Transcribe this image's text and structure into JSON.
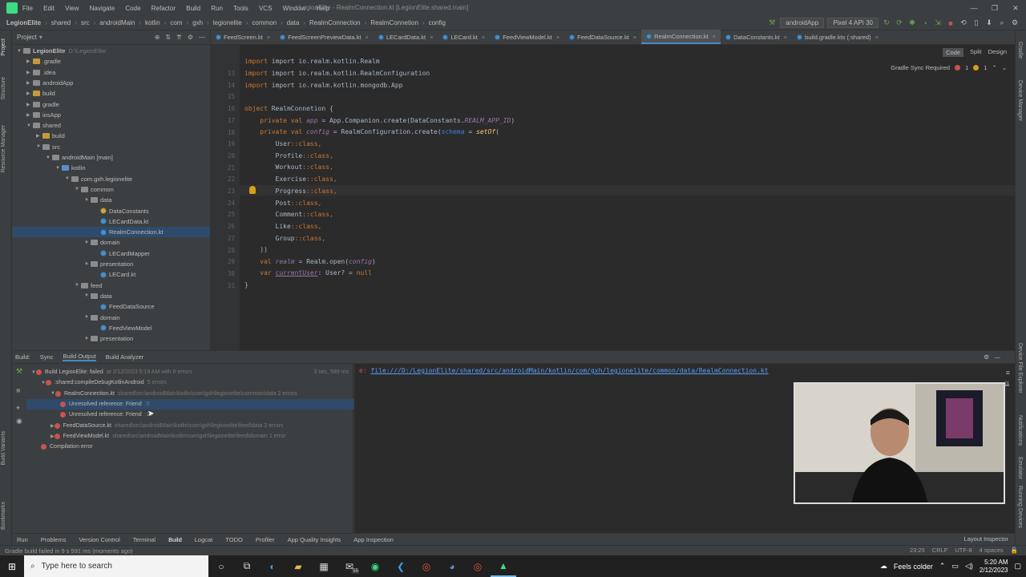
{
  "window": {
    "title": "LegionElite - RealmConnection.kt [LegionElite.shared.main]",
    "menu": [
      "File",
      "Edit",
      "View",
      "Navigate",
      "Code",
      "Refactor",
      "Build",
      "Run",
      "Tools",
      "VCS",
      "Window",
      "Help"
    ],
    "controls": [
      "—",
      "❐",
      "✕"
    ]
  },
  "breadcrumb": [
    "LegionElite",
    "shared",
    "src",
    "androidMain",
    "kotlin",
    "com",
    "gxh",
    "legionelite",
    "common",
    "data",
    "RealmConnection",
    "RealmConnetion",
    "config"
  ],
  "toolbar": {
    "run_config": "androidApp",
    "device": "Pixel 4 API 30"
  },
  "project": {
    "header": "Project",
    "tree": [
      {
        "label": "LegionElite",
        "hint": "D:\\LegionElite",
        "level": 0,
        "open": true,
        "kind": "folder"
      },
      {
        "label": ".gradle",
        "level": 1,
        "open": false,
        "kind": "folder-orange"
      },
      {
        "label": ".idea",
        "level": 1,
        "open": false,
        "kind": "folder"
      },
      {
        "label": "androidApp",
        "level": 1,
        "open": false,
        "kind": "folder"
      },
      {
        "label": "build",
        "level": 1,
        "open": false,
        "kind": "folder-orange"
      },
      {
        "label": "gradle",
        "level": 1,
        "open": false,
        "kind": "folder"
      },
      {
        "label": "iosApp",
        "level": 1,
        "open": false,
        "kind": "folder"
      },
      {
        "label": "shared",
        "level": 1,
        "open": true,
        "kind": "folder"
      },
      {
        "label": "build",
        "level": 2,
        "open": false,
        "kind": "folder-orange"
      },
      {
        "label": "src",
        "level": 2,
        "open": true,
        "kind": "folder"
      },
      {
        "label": "androidMain [main]",
        "level": 3,
        "open": true,
        "kind": "folder"
      },
      {
        "label": "kotlin",
        "level": 4,
        "open": true,
        "kind": "folder-blue"
      },
      {
        "label": "com.gxh.legionelite",
        "level": 5,
        "open": true,
        "kind": "folder"
      },
      {
        "label": "common",
        "level": 6,
        "open": true,
        "kind": "folder"
      },
      {
        "label": "data",
        "level": 7,
        "open": true,
        "kind": "folder"
      },
      {
        "label": "DataConstants",
        "level": 8,
        "kind": "kt-obj"
      },
      {
        "label": "LECardData.kt",
        "level": 8,
        "kind": "kt"
      },
      {
        "label": "RealmConnection.kt",
        "level": 8,
        "kind": "kt",
        "selected": true
      },
      {
        "label": "domain",
        "level": 7,
        "open": true,
        "kind": "folder"
      },
      {
        "label": "LECardMapper",
        "level": 8,
        "kind": "kt"
      },
      {
        "label": "presentation",
        "level": 7,
        "open": true,
        "kind": "folder"
      },
      {
        "label": "LECard.kt",
        "level": 8,
        "kind": "kt"
      },
      {
        "label": "feed",
        "level": 6,
        "open": true,
        "kind": "folder"
      },
      {
        "label": "data",
        "level": 7,
        "open": true,
        "kind": "folder"
      },
      {
        "label": "FeedDataSource",
        "level": 8,
        "kind": "kt"
      },
      {
        "label": "domain",
        "level": 7,
        "open": true,
        "kind": "folder"
      },
      {
        "label": "FeedViewModel",
        "level": 8,
        "kind": "kt"
      },
      {
        "label": "presentation",
        "level": 7,
        "open": true,
        "kind": "folder"
      }
    ]
  },
  "tabs": [
    {
      "label": "FeedScreen.kt"
    },
    {
      "label": "FeedScreenPreviewData.kt"
    },
    {
      "label": "LECardData.kt"
    },
    {
      "label": "LECard.kt"
    },
    {
      "label": "FeedViewModel.kt"
    },
    {
      "label": "FeedDataSource.kt"
    },
    {
      "label": "RealmConnection.kt",
      "active": true
    },
    {
      "label": "DataConstants.kt"
    },
    {
      "label": "build.gradle.kts (:shared)"
    }
  ],
  "editor": {
    "view_modes": [
      "Code",
      "Split",
      "Design"
    ],
    "gradle_sync": "Gradle Sync Required",
    "error_count": "1",
    "warning_count": "1",
    "line_numbers": [
      "",
      "13",
      "14",
      "15",
      "16",
      "17",
      "18",
      "19",
      "20",
      "21",
      "22",
      "23",
      "24",
      "25",
      "26",
      "27",
      "28",
      "29",
      "30",
      "31"
    ],
    "lines": {
      "l12": "import io.realm.kotlin.Realm",
      "l13": "import io.realm.kotlin.RealmConfiguration",
      "l14": "import io.realm.kotlin.mongodb.App",
      "l16a": "object ",
      "l16b": "RealmConnetion",
      "l16c": " {",
      "l17a": "    private val ",
      "l17b": "app",
      "l17c": " = App.Companion.create(DataConstants.",
      "l17d": "REALM_APP_ID",
      "l17e": ")",
      "l18a": "    private val ",
      "l18b": "config",
      "l18c": " = RealmConfiguration.create(",
      "l18d": "schema",
      "l18e": " = ",
      "l18f": "setOf",
      "l18g": "(",
      "entities": [
        "User",
        "Profile",
        "Workout",
        "Exercise",
        "Progress",
        "Post",
        "Comment",
        "Like",
        "Group"
      ],
      "l28": "    ))",
      "l29a": "    val ",
      "l29b": "realm",
      "l29c": " = Realm.open(",
      "l29d": "config",
      "l29e": ")",
      "l30a": "    var ",
      "l30b": "currentUser",
      "l30c": ": User? = ",
      "l30d": "null",
      "l31": "}"
    }
  },
  "build_panel": {
    "label": "Build:",
    "tabs": [
      "Sync",
      "Build Output",
      "Build Analyzer"
    ],
    "rows": [
      {
        "label": "Build LegionElite: failed",
        "hint": "at 2/12/2023 5:19 AM with 6 errors",
        "time": "3 sec, 589 ms",
        "level": 0
      },
      {
        "label": ":shared:compileDebugKotlinAndroid",
        "hint": "5 errors",
        "level": 1
      },
      {
        "label": "RealmConnection.kt",
        "hint": "shared\\src\\androidMain\\kotlin\\com\\gxh\\legionelite\\common\\data 2 errors",
        "level": 2
      },
      {
        "label": "Unresolved reference: Friend",
        "hint": ":5",
        "level": 3,
        "selected": true
      },
      {
        "label": "Unresolved reference: Friend",
        "hint": ":25",
        "level": 3
      },
      {
        "label": "FeedDataSource.kt",
        "hint": "shared\\src\\androidMain\\kotlin\\com\\gxh\\legionelite\\feed\\data 2 errors",
        "level": 2
      },
      {
        "label": "FeedViewModel.kt",
        "hint": "shared\\src\\androidMain\\kotlin\\com\\gxh\\legionelite\\feed\\domain 1 error",
        "level": 2
      },
      {
        "label": "Compilation error",
        "hint": "",
        "level": 1
      }
    ],
    "output_prefix": "e: ",
    "output_link": "file:///D:/LegionElite/shared/src/androidMain/kotlin/com/gxh/legionelite/common/data/RealmConnection.kt"
  },
  "bottom_tools": [
    "Run",
    "Problems",
    "Version Control",
    "Terminal",
    "Build",
    "Logcat",
    "TODO",
    "Profiler",
    "App Quality Insights",
    "App Inspection"
  ],
  "layout_inspector": "Layout Inspector",
  "status": {
    "message": "Gradle build failed in 9 s 591 ms (moments ago)",
    "position": "23:25",
    "line_sep": "CRLF",
    "encoding": "UTF-8",
    "indent": "4 spaces"
  },
  "taskbar": {
    "search_placeholder": "Type here to search",
    "weather": "Feels colder",
    "time": "5:20 AM",
    "date": "2/12/2023",
    "mail_badge": "55"
  },
  "stripes": {
    "left": [
      "Project",
      "Structure",
      "Resource Manager",
      "Bookmarks",
      "Build Variants"
    ],
    "right": [
      "Gradle",
      "Device Manager",
      "Notifications",
      "Emulator",
      "Device File Explorer",
      "Running Devices"
    ]
  }
}
